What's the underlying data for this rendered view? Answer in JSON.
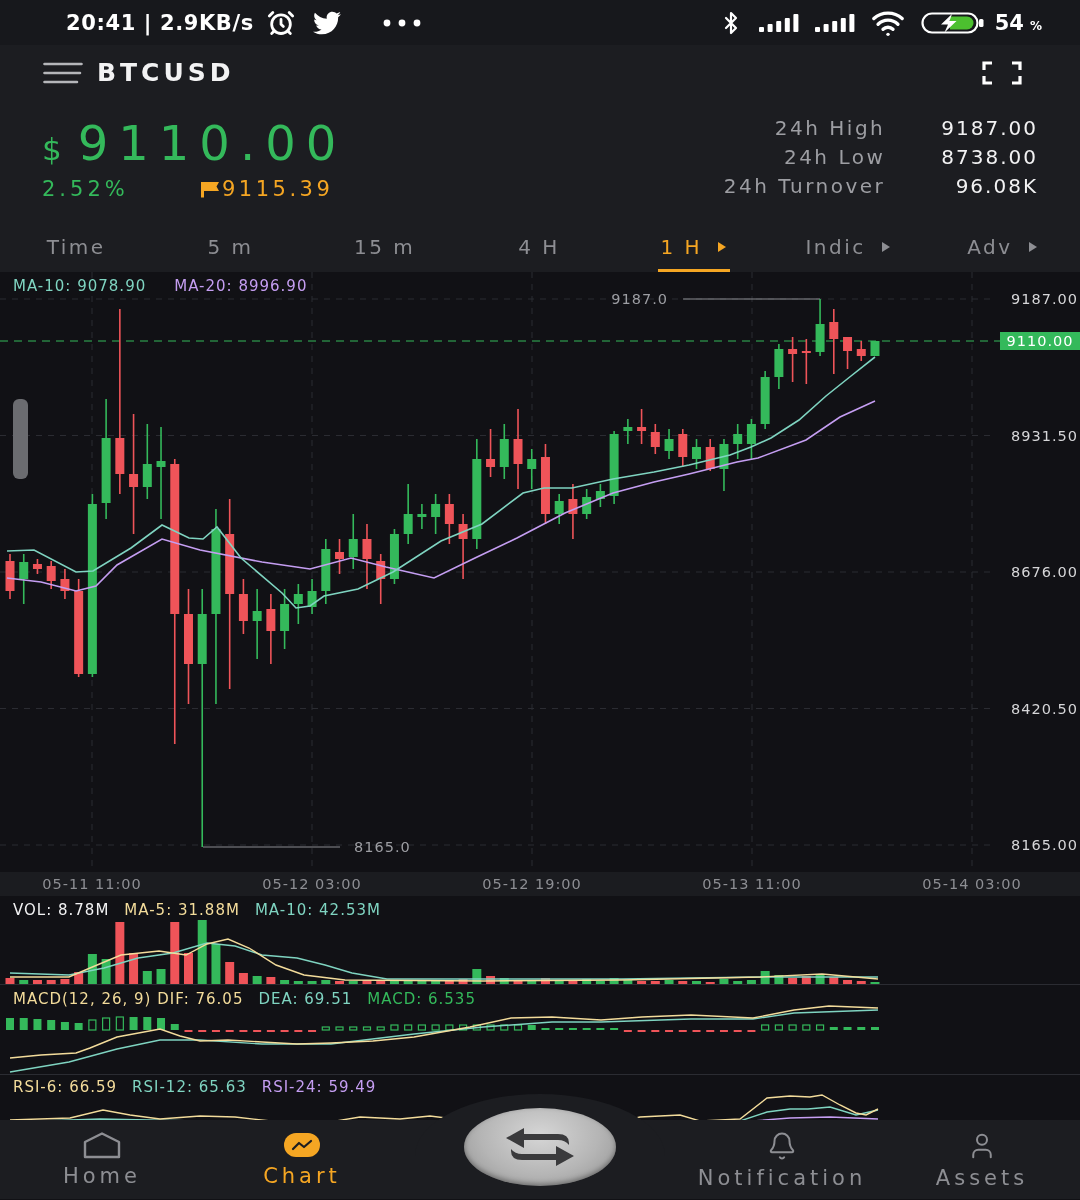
{
  "status_bar": {
    "time_and_speed": "20:41 | 2.9KB/s",
    "battery": "54",
    "battery_unit": "%"
  },
  "header": {
    "symbol": "BTCUSD"
  },
  "ticker": {
    "currency": "$",
    "price": "9110.00",
    "change": "2.52%",
    "mark_price": "9115.39",
    "stats": [
      {
        "label": "24h High",
        "value": "9187.00"
      },
      {
        "label": "24h Low",
        "value": "8738.00"
      },
      {
        "label": "24h Turnover",
        "value": "96.08K"
      }
    ]
  },
  "tabs": [
    {
      "label": "Time",
      "selected": false,
      "dropdown": false
    },
    {
      "label": "5 m",
      "selected": false,
      "dropdown": false
    },
    {
      "label": "15 m",
      "selected": false,
      "dropdown": false
    },
    {
      "label": "4 H",
      "selected": false,
      "dropdown": false
    },
    {
      "label": "1 H",
      "selected": true,
      "dropdown": true
    },
    {
      "label": "Indic",
      "selected": false,
      "dropdown": true
    },
    {
      "label": "Adv",
      "selected": false,
      "dropdown": true
    }
  ],
  "chart": {
    "legend": [
      {
        "text": "MA-10: 9078.90",
        "color": "#7fd4c1"
      },
      {
        "text": "MA-20: 8996.90",
        "color": "#c59ef2"
      }
    ],
    "y_labels": [
      "9187.00",
      "8931.50",
      "8676.00",
      "8420.50",
      "8165.00"
    ],
    "last_price": "9110.00",
    "high_marker": "9187.0",
    "low_marker": "8165.0",
    "x_labels": [
      "05-11 11:00",
      "05-12 03:00",
      "05-12 19:00",
      "05-13 11:00",
      "05-14 03:00"
    ]
  },
  "volume": {
    "legend": [
      {
        "text": "VOL: 8.78M",
        "color": "#f2f2f3"
      },
      {
        "text": "MA-5: 31.88M",
        "color": "#f3dc9b"
      },
      {
        "text": "MA-10: 42.53M",
        "color": "#7fd4c1"
      }
    ]
  },
  "macd": {
    "legend": [
      {
        "text": "MACD(12, 26, 9) DIF: 76.05",
        "color": "#f3dc9b"
      },
      {
        "text": "DEA: 69.51",
        "color": "#7fd4c1"
      },
      {
        "text": "MACD: 6.535",
        "color": "#34b95b"
      }
    ]
  },
  "rsi": {
    "legend": [
      {
        "text": "RSI-6: 66.59",
        "color": "#f3dc9b"
      },
      {
        "text": "RSI-12: 65.63",
        "color": "#7fd4c1"
      },
      {
        "text": "RSI-24: 59.49",
        "color": "#c59ef2"
      }
    ]
  },
  "bottom_nav": [
    {
      "label": "Home",
      "selected": false
    },
    {
      "label": "Chart",
      "selected": true
    },
    {
      "label": "Notification",
      "selected": false
    },
    {
      "label": "Assets",
      "selected": false
    }
  ]
}
